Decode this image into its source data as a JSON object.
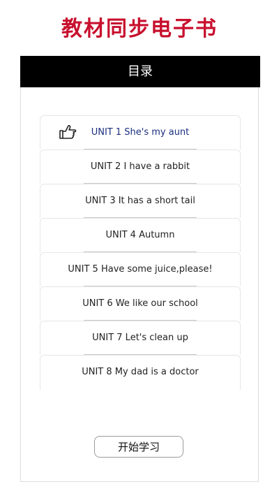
{
  "app": {
    "title": "教材同步电子书"
  },
  "toc": {
    "header": "目录",
    "units": [
      {
        "label": "UNIT 1  She's my aunt",
        "active": true,
        "icon": "pointing-hand-icon"
      },
      {
        "label": "UNIT 2  I have a rabbit",
        "active": false
      },
      {
        "label": "UNIT 3  It has a short tail",
        "active": false
      },
      {
        "label": "UNIT 4  Autumn",
        "active": false
      },
      {
        "label": "UNIT 5  Have some juice,please!",
        "active": false
      },
      {
        "label": "UNIT 6  We like our school",
        "active": false
      },
      {
        "label": "UNIT 7  Let's clean up",
        "active": false
      },
      {
        "label": "UNIT 8  My dad is a doctor",
        "active": false
      }
    ]
  },
  "footer": {
    "start_label": "开始学习"
  },
  "colors": {
    "title": "#c8102e",
    "header_bg": "#000000",
    "active_text": "#1a2e80"
  }
}
